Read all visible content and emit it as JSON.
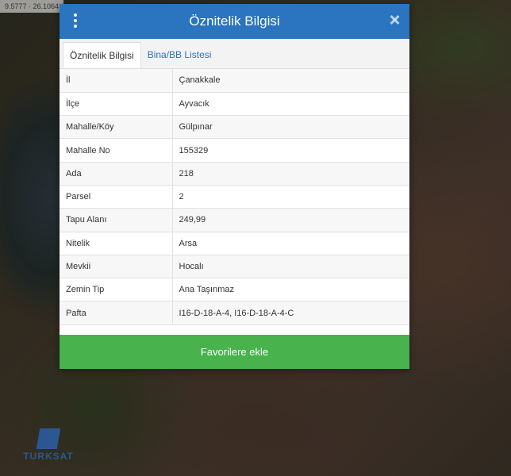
{
  "map": {
    "coords": "9.5777 · 26.1064",
    "logo_text": "TURKSAT"
  },
  "dialog": {
    "title": "Öznitelik Bilgisi",
    "tabs": [
      {
        "label": "Öznitelik Bilgisi",
        "active": true
      },
      {
        "label": "Bina/BB Listesi",
        "active": false
      }
    ],
    "rows": [
      {
        "key": "İl",
        "value": "Çanakkale"
      },
      {
        "key": "İlçe",
        "value": "Ayvacık"
      },
      {
        "key": "Mahalle/Köy",
        "value": "Gülpınar"
      },
      {
        "key": "Mahalle No",
        "value": "155329"
      },
      {
        "key": "Ada",
        "value": "218"
      },
      {
        "key": "Parsel",
        "value": "2"
      },
      {
        "key": "Tapu Alanı",
        "value": "249,99"
      },
      {
        "key": "Nitelik",
        "value": "Arsa"
      },
      {
        "key": "Mevkii",
        "value": "Hocalı"
      },
      {
        "key": "Zemin Tip",
        "value": "Ana Taşınmaz"
      },
      {
        "key": "Pafta",
        "value": "I16-D-18-A-4, I16-D-18-A-4-C"
      }
    ],
    "favorite_button": "Favorilere ekle"
  },
  "colors": {
    "header_blue": "#2a74c0",
    "button_green": "#48b24d"
  }
}
